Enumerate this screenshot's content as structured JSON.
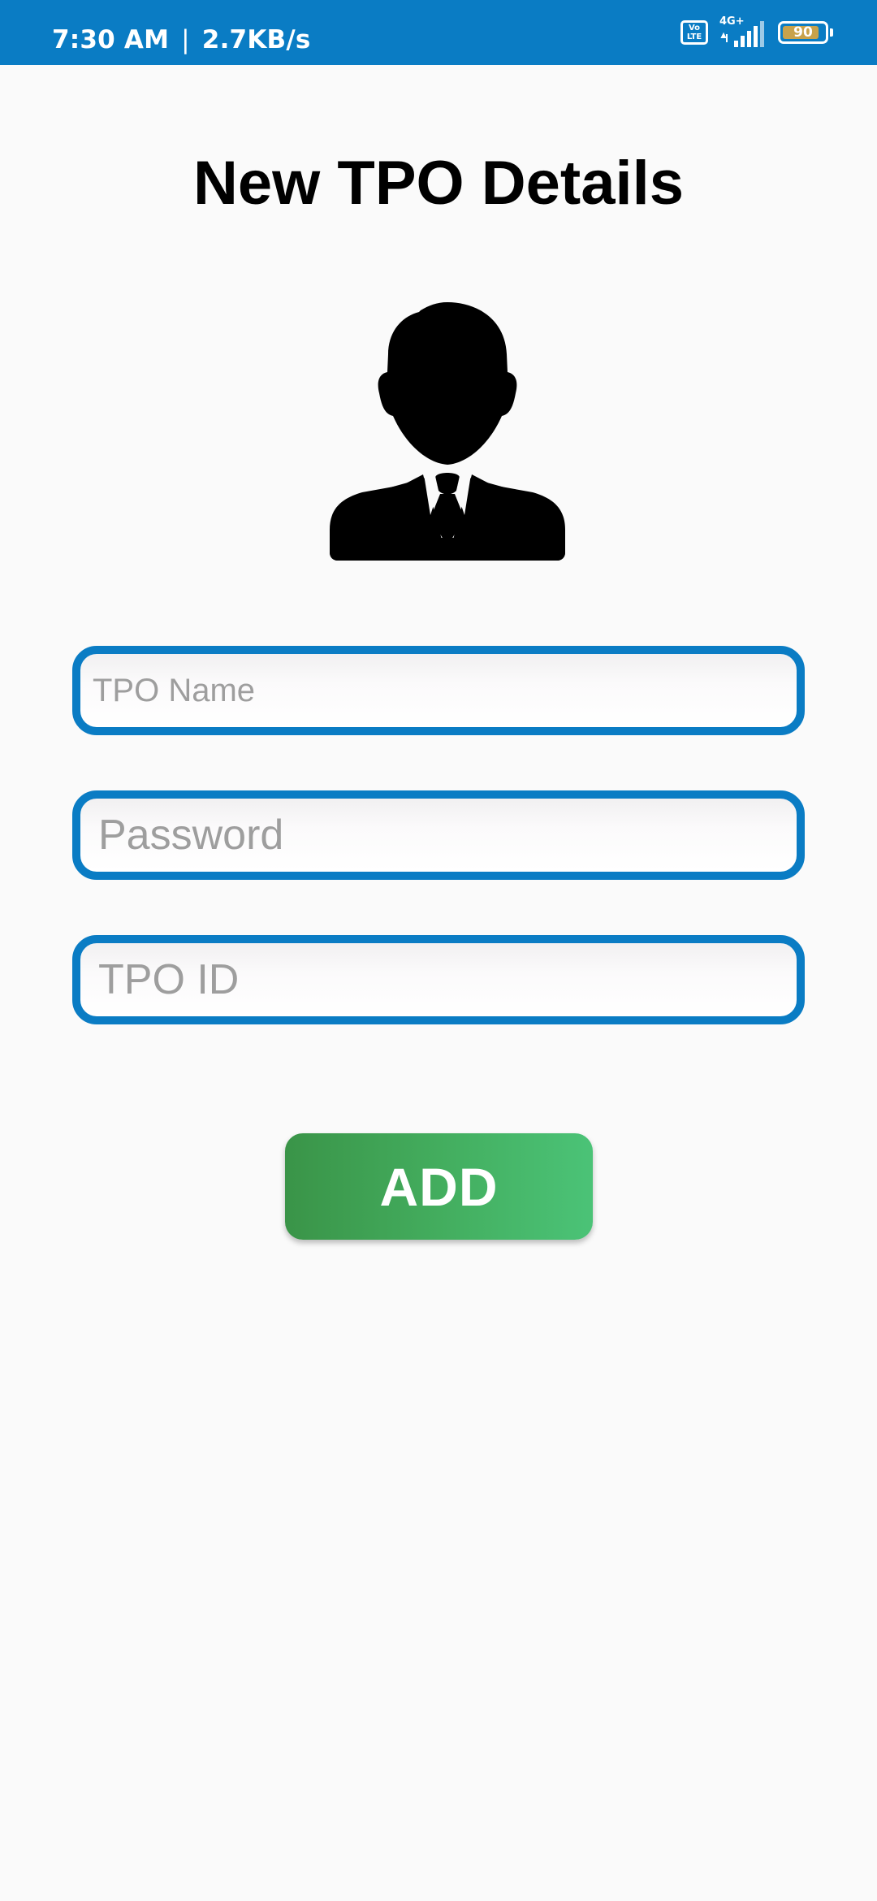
{
  "status_bar": {
    "time": "7:30 AM",
    "separator": "|",
    "net_speed": "2.7KB/s",
    "volte_label": "Vo LTE",
    "network_type": "4G+",
    "battery_level": "90",
    "background_color": "#0a7cc4",
    "battery_fill_color": "#c8a24b"
  },
  "screen": {
    "title": "New TPO Details",
    "avatar_icon": "person-with-tie-icon"
  },
  "form": {
    "fields": [
      {
        "name": "tpo-name",
        "placeholder": "TPO Name",
        "value": ""
      },
      {
        "name": "password",
        "placeholder": "Password",
        "value": ""
      },
      {
        "name": "tpo-id",
        "placeholder": "TPO ID",
        "value": ""
      }
    ],
    "border_color": "#0a7cc4",
    "submit_label": "ADD",
    "submit_gradient": [
      "#3a9448",
      "#4bc377"
    ]
  }
}
